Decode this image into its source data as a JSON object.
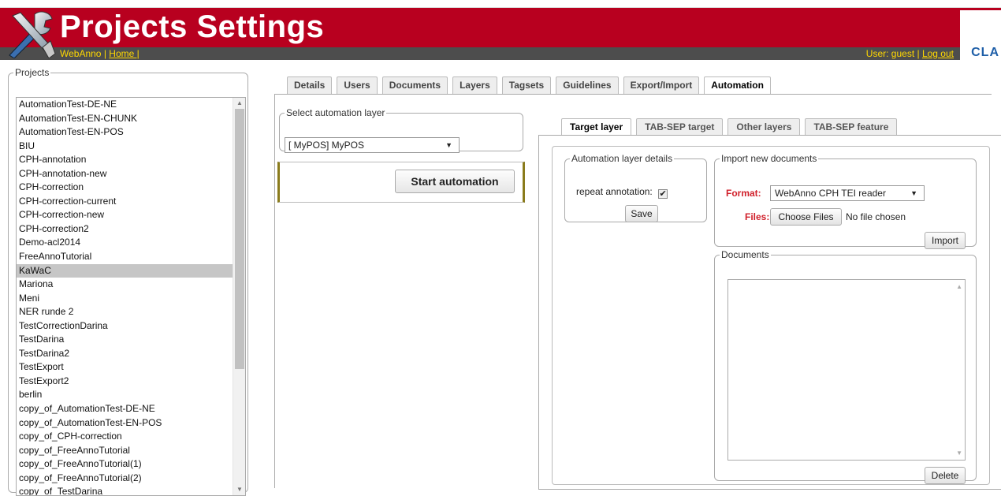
{
  "header": {
    "title": "Projects Settings",
    "breadcrumb_app": "WebAnno",
    "breadcrumb_sep": " | ",
    "breadcrumb_home": "Home |",
    "user_text": "User: guest | ",
    "logout": "Log out",
    "brand": "CLA"
  },
  "projects": {
    "legend": "Projects",
    "items": [
      "AutomationTest-DE-NE",
      "AutomationTest-EN-CHUNK",
      "AutomationTest-EN-POS",
      "BIU",
      "CPH-annotation",
      "CPH-annotation-new",
      "CPH-correction",
      "CPH-correction-current",
      "CPH-correction-new",
      "CPH-correction2",
      "Demo-acl2014",
      "FreeAnnoTutorial",
      "KaWaC",
      "Mariona",
      "Meni",
      "NER runde 2",
      "TestCorrectionDarina",
      "TestDarina",
      "TestDarina2",
      "TestExport",
      "TestExport2",
      "berlin",
      "copy_of_AutomationTest-DE-NE",
      "copy_of_AutomationTest-EN-POS",
      "copy_of_CPH-correction",
      "copy_of_FreeAnnoTutorial",
      "copy_of_FreeAnnoTutorial(1)",
      "copy_of_FreeAnnoTutorial(2)",
      "copy_of_TestDarina"
    ],
    "selected": "KaWaC"
  },
  "tabs": [
    "Details",
    "Users",
    "Documents",
    "Layers",
    "Tagsets",
    "Guidelines",
    "Export/Import",
    "Automation"
  ],
  "active_tab": "Automation",
  "automation": {
    "select_legend": "Select automation layer",
    "selected_layer": "[ MyPOS] MyPOS",
    "start_button": "Start automation"
  },
  "subtabs": [
    "Target layer",
    "TAB-SEP target",
    "Other layers",
    "TAB-SEP feature"
  ],
  "active_subtab": "Target layer",
  "layer_details": {
    "legend": "Automation layer details",
    "repeat_label": "repeat annotation:",
    "repeat_checked": true,
    "check_mark": "✔",
    "save": "Save"
  },
  "import": {
    "legend": "Import new documents",
    "format_label": "Format:",
    "format_value": "WebAnno CPH TEI reader",
    "files_label": "Files:",
    "choose_button": "Choose Files",
    "no_file": "No file chosen",
    "import_button": "Import"
  },
  "documents": {
    "legend": "Documents",
    "delete_button": "Delete"
  },
  "colors": {
    "header_red": "#b8001f",
    "subbar_gray": "#4d4d4d",
    "link_yellow": "#ffd800",
    "label_red": "#d01f2a",
    "brand_blue": "#1f5fa8"
  }
}
